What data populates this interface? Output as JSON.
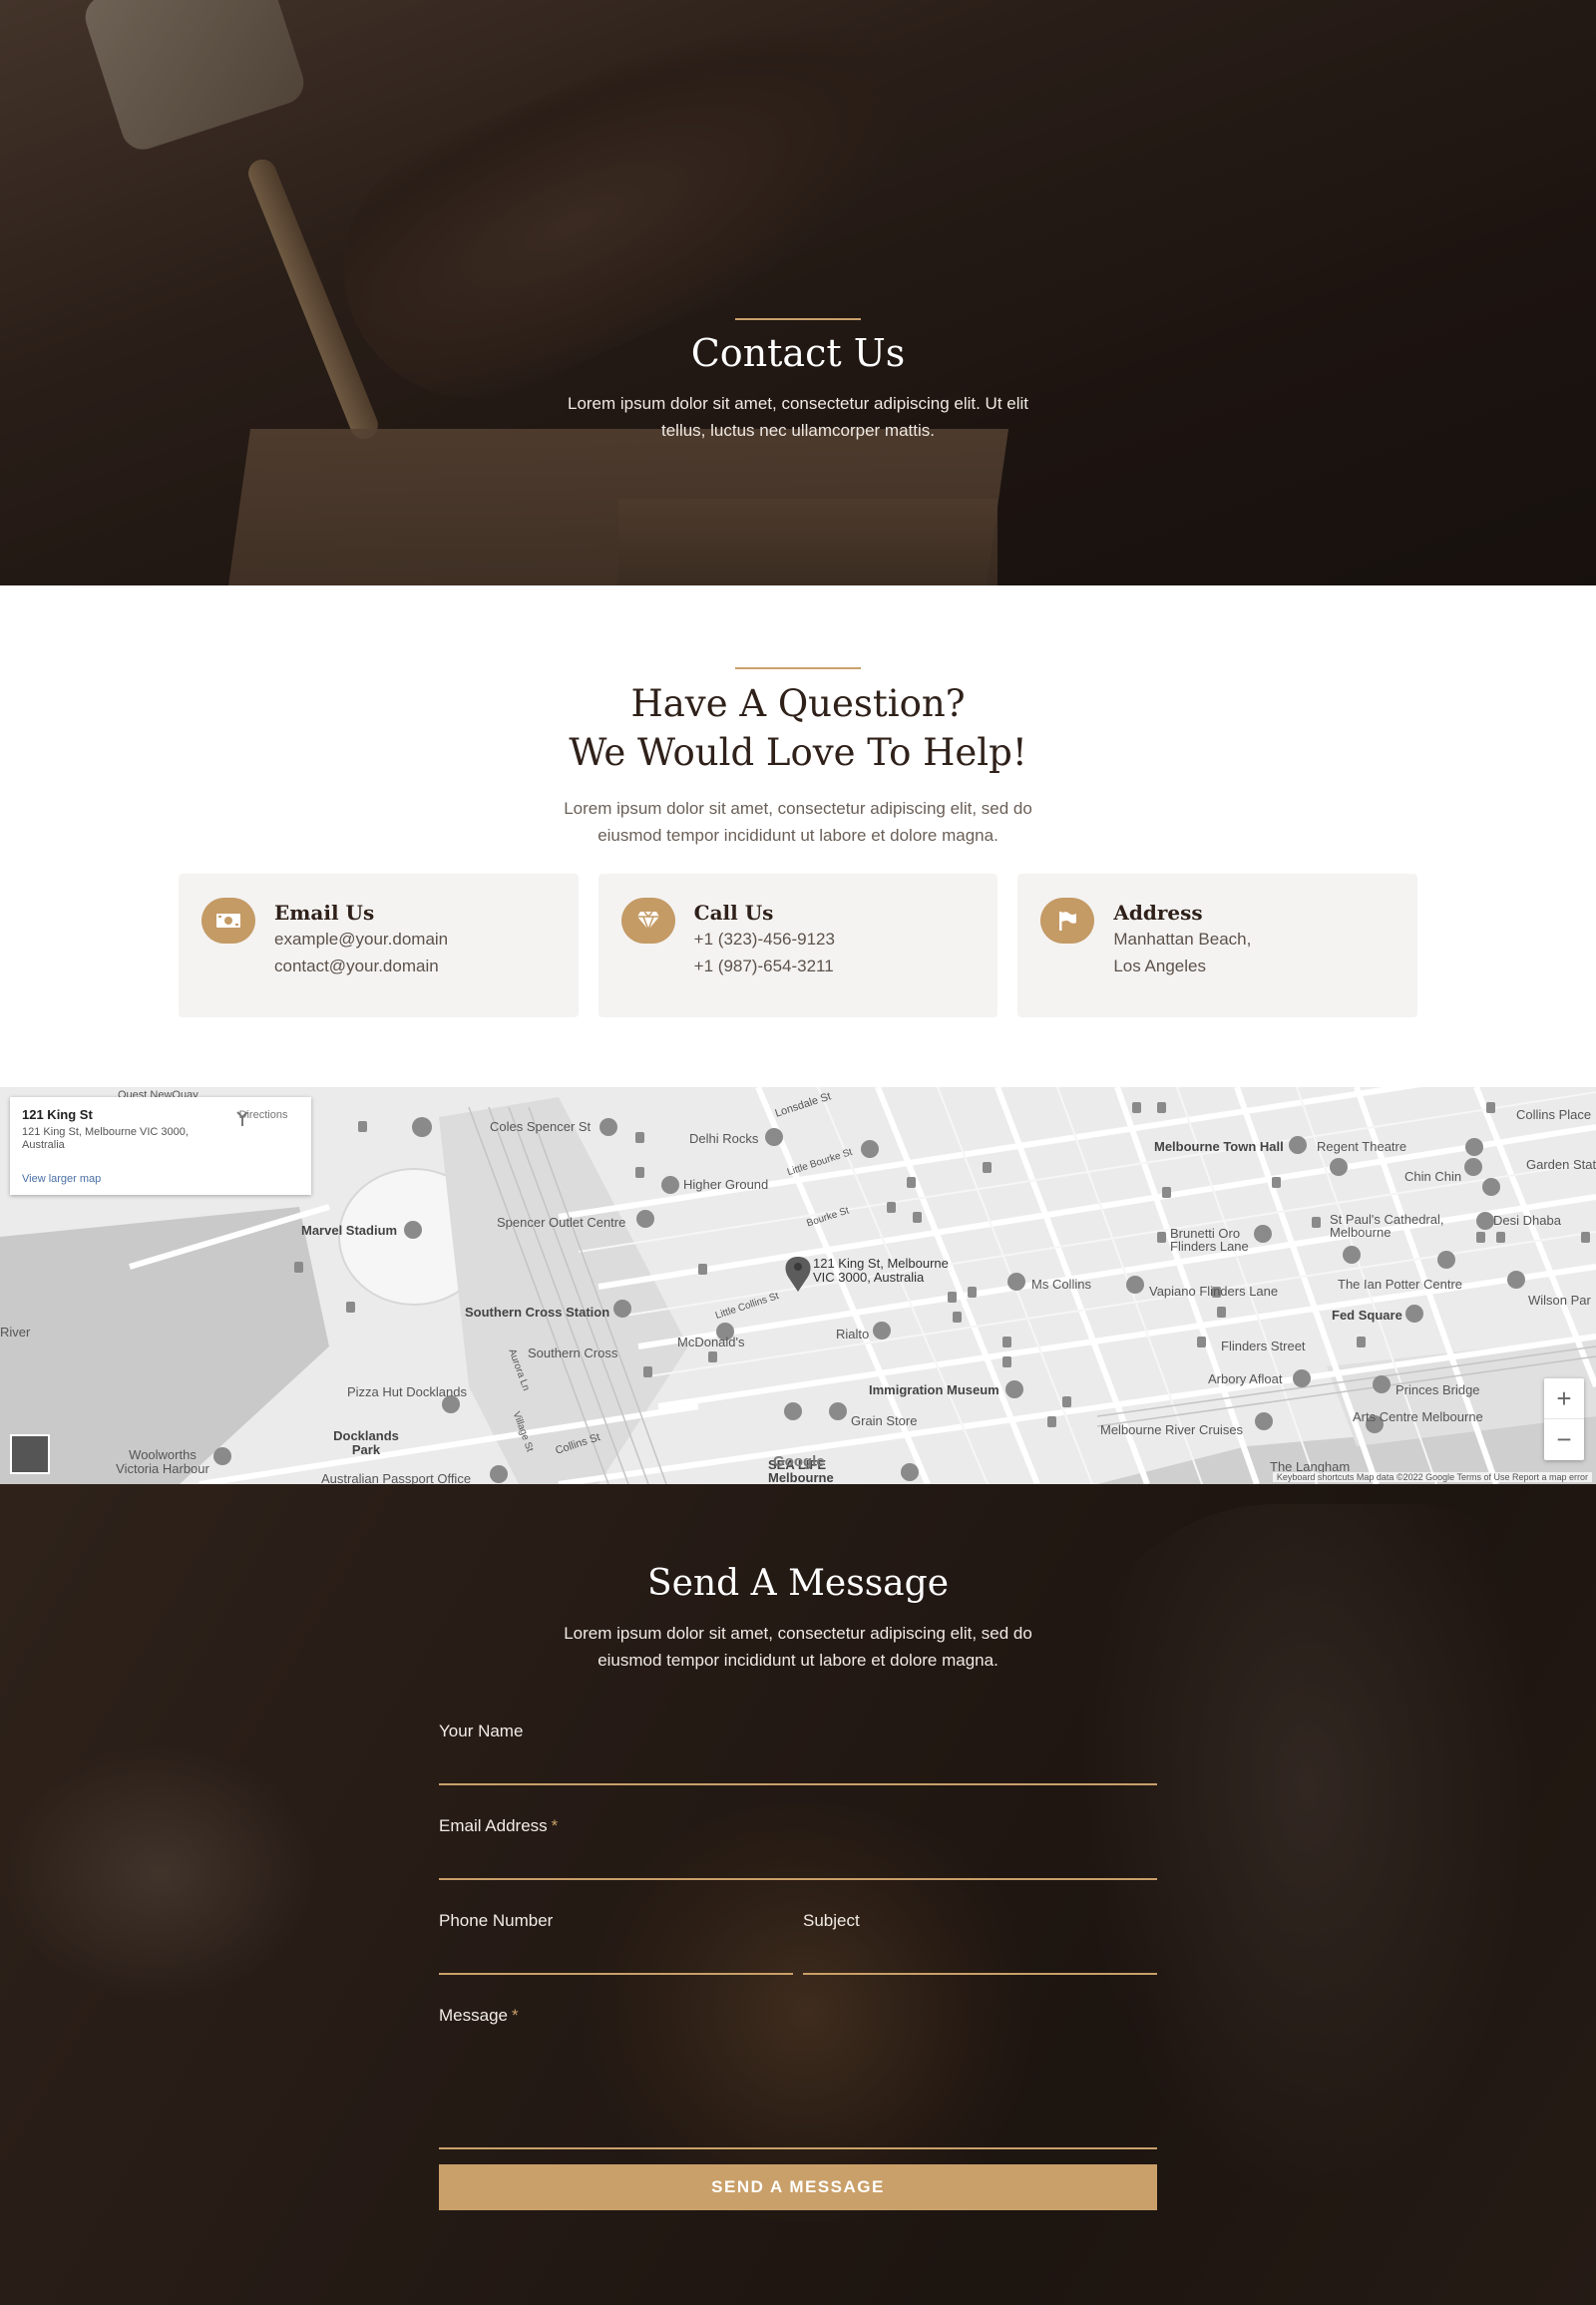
{
  "hero": {
    "title": "Contact Us",
    "text": "Lorem ipsum dolor sit amet, consectetur adipiscing elit. Ut elit tellus, luctus nec ullamcorper mattis."
  },
  "question": {
    "title_line1": "Have A Question?",
    "title_line2": "We Would Love To Help!",
    "text": "Lorem ipsum dolor sit amet, consectetur adipiscing elit, sed do eiusmod tempor incididunt ut labore et dolore magna.",
    "cards": [
      {
        "title": "Email Us",
        "line1": "example@your.domain",
        "line2": "contact@your.domain",
        "icon": "money-icon"
      },
      {
        "title": "Call Us",
        "line1": "+1 (323)-456-9123",
        "line2": "+1 (987)-654-3211",
        "icon": "diamond-icon"
      },
      {
        "title": "Address",
        "line1": "Manhattan Beach,",
        "line2": "Los Angeles",
        "icon": "flag-icon"
      }
    ]
  },
  "map": {
    "info_title": "121 King St",
    "info_address": "121 King St, Melbourne VIC 3000, Australia",
    "info_link": "View larger map",
    "directions": "Directions",
    "pin_label": "121 King St, Melbourne VIC 3000, Australia",
    "labels": {
      "marvel": "Marvel Stadium",
      "coles": "Coles Spencer St",
      "delhi": "Delhi Rocks",
      "higher": "Higher Ground",
      "spencer_outlet": "Spencer Outlet Centre",
      "southern_cross_station": "Southern Cross Station",
      "southern_cross": "Southern Cross",
      "mcdonalds": "McDonald's",
      "rialto": "Rialto",
      "immigration": "Immigration Museum",
      "grain": "Grain Store",
      "sealife": "SEA LIFE Melbourne Aquarium",
      "pizza": "Pizza Hut Docklands",
      "docklands": "Docklands Park",
      "woolworths": "Woolworths Victoria Harbour",
      "passport": "Australian Passport Office",
      "town_hall": "Melbourne Town Hall",
      "regent": "Regent Theatre",
      "chin": "Chin Chin",
      "garden": "Garden State",
      "collins_place": "Collins Place",
      "paul": "St Paul's Cathedral, Melbourne",
      "desi": "Desi Dhaba",
      "brunetti": "Brunetti Oro Flinders Lane",
      "ms_collins": "Ms Collins",
      "vapiano": "Vapiano Flinders Lane",
      "potter": "The Ian Potter Centre",
      "wilson": "Wilson Par",
      "fed": "Fed Square",
      "flinders": "Flinders Street",
      "arbory": "Arbory Afloat",
      "princes": "Princes Bridge",
      "arts": "Arts Centre Melbourne",
      "river_cruises": "Melbourne River Cruises",
      "langham": "The Langham",
      "river": "River",
      "lonsdale": "Lonsdale St",
      "little_bourke": "Little Bourke St",
      "bourke": "Bourke St",
      "little_collins": "Little Collins St",
      "collins": "Collins St",
      "aurora": "Aurora Ln",
      "village": "Village St",
      "quest": "Quest NewQuay"
    },
    "google": "Google",
    "footer": "Keyboard shortcuts   Map data ©2022 Google   Terms of Use   Report a map error",
    "zoom_in": "+",
    "zoom_out": "−"
  },
  "message": {
    "title": "Send A Message",
    "text": "Lorem ipsum dolor sit amet, consectetur adipiscing elit, sed do eiusmod tempor incididunt ut labore et dolore magna.",
    "name_label": "Your Name",
    "email_label": "Email Address",
    "phone_label": "Phone Number",
    "subject_label": "Subject",
    "message_label": "Message",
    "required_mark": "*",
    "button": "SEND A MESSAGE"
  },
  "colors": {
    "accent": "#c9a06a",
    "icon_bg": "#c49a65",
    "dark_text": "#2f211a"
  }
}
